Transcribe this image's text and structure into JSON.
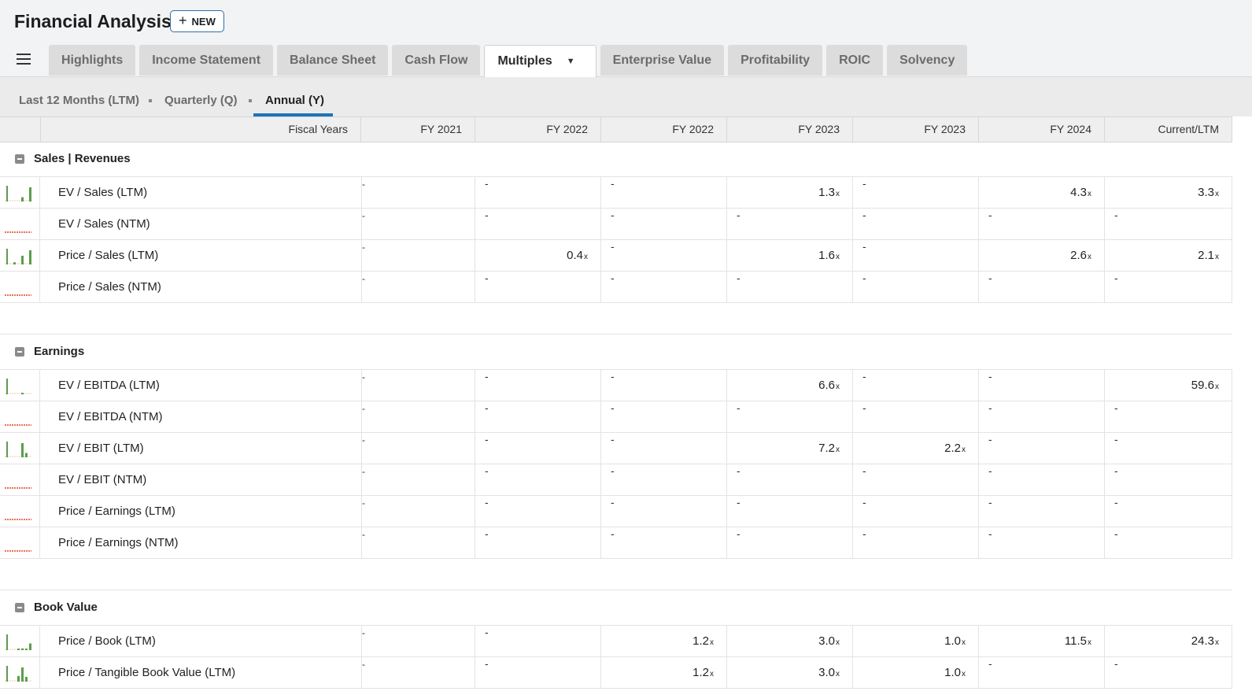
{
  "app": {
    "title": "Financial Analysis",
    "new_label": "NEW"
  },
  "tabs": [
    "Highlights",
    "Income Statement",
    "Balance Sheet",
    "Cash Flow",
    "Multiples",
    "Enterprise Value",
    "Profitability",
    "ROIC",
    "Solvency"
  ],
  "active_tab": "Multiples",
  "periods": [
    "Last 12 Months (LTM)",
    "Quarterly (Q)",
    "Annual (Y)"
  ],
  "active_period": "Annual (Y)",
  "columns": {
    "label": "Fiscal Years",
    "years": [
      "FY 2021",
      "FY 2022",
      "FY 2022",
      "FY 2023",
      "FY 2023",
      "FY 2024",
      "Current/LTM"
    ]
  },
  "sections": [
    {
      "title": "Sales | Revenues",
      "rows": [
        {
          "label": "EV / Sales (LTM)",
          "values": [
            null,
            null,
            null,
            "1.3",
            null,
            "4.3",
            "3.3"
          ],
          "spark": "green"
        },
        {
          "label": "EV / Sales (NTM)",
          "values": [
            null,
            null,
            null,
            null,
            null,
            null,
            null
          ],
          "spark": "red"
        },
        {
          "label": "Price / Sales (LTM)",
          "values": [
            null,
            "0.4",
            null,
            "1.6",
            null,
            "2.6",
            "2.1"
          ],
          "spark": "green"
        },
        {
          "label": "Price / Sales (NTM)",
          "values": [
            null,
            null,
            null,
            null,
            null,
            null,
            null
          ],
          "spark": "red"
        }
      ]
    },
    {
      "title": "Earnings",
      "rows": [
        {
          "label": "EV / EBITDA (LTM)",
          "values": [
            null,
            null,
            null,
            "6.6",
            null,
            null,
            "59.6"
          ],
          "spark": "green"
        },
        {
          "label": "EV / EBITDA (NTM)",
          "values": [
            null,
            null,
            null,
            null,
            null,
            null,
            null
          ],
          "spark": "red"
        },
        {
          "label": "EV / EBIT (LTM)",
          "values": [
            null,
            null,
            null,
            "7.2",
            "2.2",
            null,
            null
          ],
          "spark": "green"
        },
        {
          "label": "EV / EBIT (NTM)",
          "values": [
            null,
            null,
            null,
            null,
            null,
            null,
            null
          ],
          "spark": "red"
        },
        {
          "label": "Price / Earnings (LTM)",
          "values": [
            null,
            null,
            null,
            null,
            null,
            null,
            null
          ],
          "spark": "red"
        },
        {
          "label": "Price / Earnings (NTM)",
          "values": [
            null,
            null,
            null,
            null,
            null,
            null,
            null
          ],
          "spark": "red"
        }
      ]
    },
    {
      "title": "Book Value",
      "rows": [
        {
          "label": "Price / Book (LTM)",
          "values": [
            null,
            null,
            "1.2",
            "3.0",
            "1.0",
            "11.5",
            "24.3"
          ],
          "spark": "green"
        },
        {
          "label": "Price / Tangible Book Value (LTM)",
          "values": [
            null,
            null,
            "1.2",
            "3.0",
            "1.0",
            null,
            null
          ],
          "spark": "green"
        }
      ]
    }
  ],
  "unit_suffix": "x",
  "dash": "-",
  "colors": {
    "spark_green": "#5a9e4b",
    "spark_red": "#e8735a",
    "accent": "#1f73b7"
  }
}
